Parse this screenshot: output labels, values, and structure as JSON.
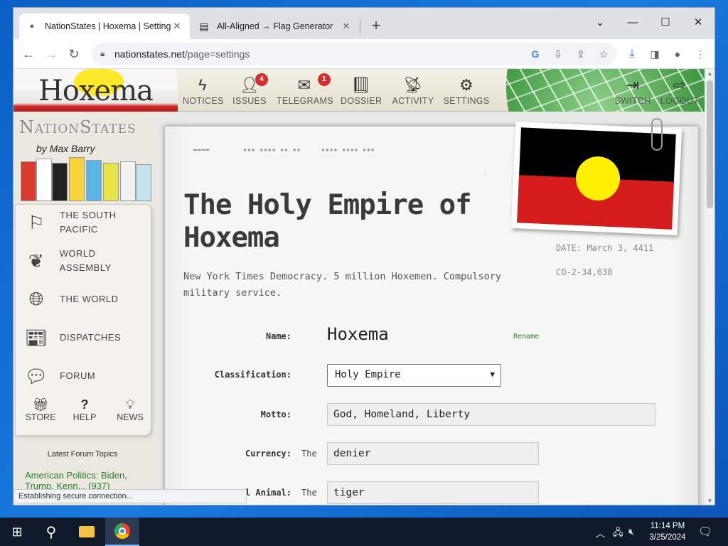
{
  "browser": {
    "tabs": [
      {
        "title": "NationStates | Hoxema | Settings",
        "favicon": "ns-favicon-icon"
      },
      {
        "title": "All-Aligned → Flag Generator",
        "favicon": "flag-doc-icon"
      }
    ],
    "url_host": "nationstates.net",
    "url_path": "/page=settings",
    "status": "Establishing secure connection..."
  },
  "nsheader": {
    "nation_short": "Hoxema",
    "nav": [
      {
        "label": "NOTICES",
        "icon": "lightning-icon",
        "badge": ""
      },
      {
        "label": "ISSUES",
        "icon": "person-icon",
        "badge": "4"
      },
      {
        "label": "TELEGRAMS",
        "icon": "envelope-icon",
        "badge": "1"
      },
      {
        "label": "DOSSIER",
        "icon": "book-icon",
        "badge": ""
      },
      {
        "label": "ACTIVITY",
        "icon": "satellite-icon",
        "badge": ""
      },
      {
        "label": "SETTINGS",
        "icon": "gears-icon",
        "badge": ""
      }
    ],
    "switch_label": "SWITCH",
    "logout_label": "LOGOUT"
  },
  "sidebar": {
    "logo": "NationStates",
    "byline": "by Max Barry",
    "items": [
      {
        "label": "THE SOUTH PACIFIC",
        "icon": "flag-icon"
      },
      {
        "label": "WORLD ASSEMBLY",
        "icon": "laurel-icon"
      },
      {
        "label": "THE WORLD",
        "icon": "globe-icon"
      },
      {
        "label": "DISPATCHES",
        "icon": "newspaper-icon"
      },
      {
        "label": "FORUM",
        "icon": "chat-bubbles-icon"
      }
    ],
    "mini": [
      {
        "label": "STORE",
        "icon": "gift-icon"
      },
      {
        "label": "HELP",
        "icon": "question-icon"
      },
      {
        "label": "NEWS",
        "icon": "lightbulb-icon"
      }
    ],
    "forum_title": "Latest Forum Topics",
    "forum_link": "American Politics: Biden, Trump, Kenn... (937)"
  },
  "nation": {
    "full_name": "The Holy Empire of Hoxema",
    "tagline": "New York Times Democracy. 5 million Hoxemen. Compulsory military service.",
    "date": "DATE: March 3, 4411",
    "code": "CO-2-34,030"
  },
  "form": {
    "name_label": "Name:",
    "name_value": "Hoxema",
    "rename": "Rename",
    "classification_label": "Classification:",
    "classification_value": "Holy Empire",
    "motto_label": "Motto:",
    "motto_value": "God, Homeland, Liberty",
    "currency_label": "Currency:",
    "currency_prefix": "The",
    "currency_value": "denier",
    "animal_label": "l Animal:",
    "animal_prefix": "The",
    "animal_value": "tiger"
  },
  "taskbar": {
    "time": "11:14 PM",
    "date": "3/25/2024"
  },
  "colors": {
    "flag_black": "#000000",
    "flag_red": "#d71c1c",
    "flag_yellow": "#ffef00",
    "badge_red": "#d32f2f",
    "link_green": "#2a7f2a"
  }
}
